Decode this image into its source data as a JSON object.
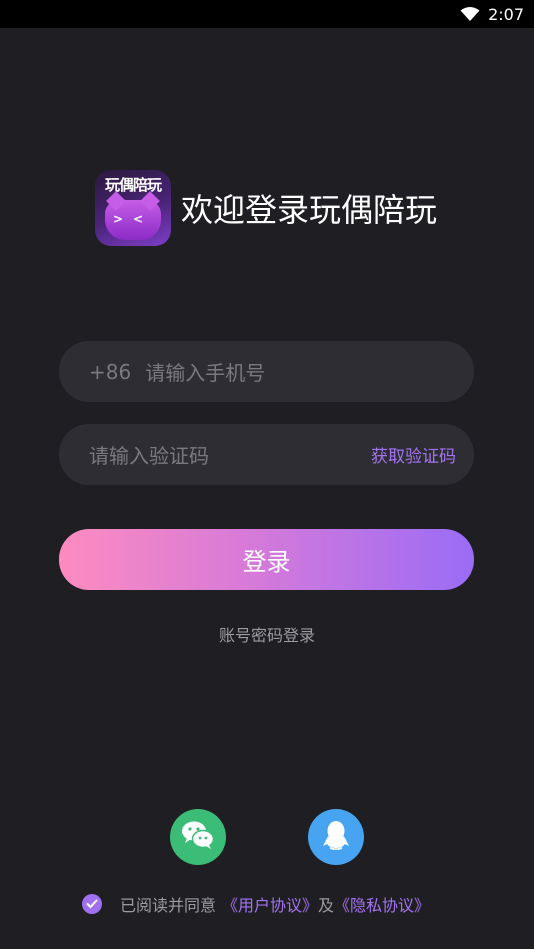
{
  "status_bar": {
    "time": "2:07",
    "icons": [
      "wifi-icon"
    ]
  },
  "header": {
    "logo_text": "玩偶陪玩",
    "logo_eyes": "><",
    "welcome": "欢迎登录玩偶陪玩"
  },
  "phone": {
    "prefix": "+86",
    "placeholder": "请输入手机号"
  },
  "code": {
    "placeholder": "请输入验证码",
    "get_code_label": "获取验证码"
  },
  "login_button": "登录",
  "password_login": "账号密码登录",
  "social": [
    "wechat-icon",
    "qq-icon"
  ],
  "agreement": {
    "checked": true,
    "prefix": "已阅读并同意",
    "user_agreement": "《用户协议》",
    "and": "及",
    "privacy_agreement": "《隐私协议》"
  },
  "colors": {
    "background": "#1f1e23",
    "field": "#2e2d33",
    "accent": "#a374f0",
    "button_gradient_start": "#fd8bc0",
    "button_gradient_end": "#9a6cf6",
    "wechat": "#3bbd78",
    "qq": "#47a4f0"
  }
}
